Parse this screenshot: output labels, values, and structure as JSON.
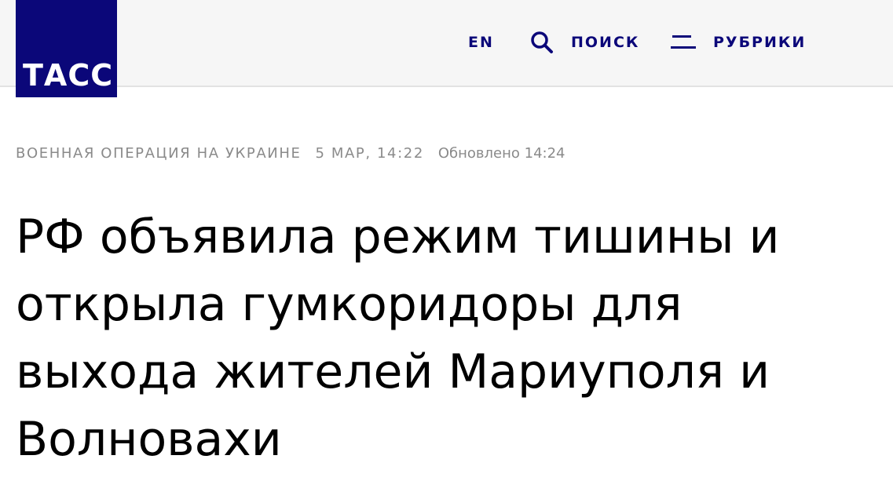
{
  "header": {
    "logo_text": "ТАСС",
    "nav": {
      "lang_label": "EN",
      "search_label": "ПОИСК",
      "rubrics_label": "РУБРИКИ"
    }
  },
  "article": {
    "category": "ВОЕННАЯ ОПЕРАЦИЯ НА УКРАИНЕ",
    "date": "5 МАР, 14:22",
    "updated": "Обновлено 14:24",
    "title": "РФ объявила режим тишины и открыла гумкоридоры для выхода жителей Мариуполя и Волновахи"
  },
  "colors": {
    "brand": "#0b0779",
    "header_bg": "#f6f6f6",
    "meta_text": "#8a8a8a",
    "title_text": "#000000"
  },
  "icons": {
    "search": "search-icon",
    "menu": "menu-icon"
  }
}
